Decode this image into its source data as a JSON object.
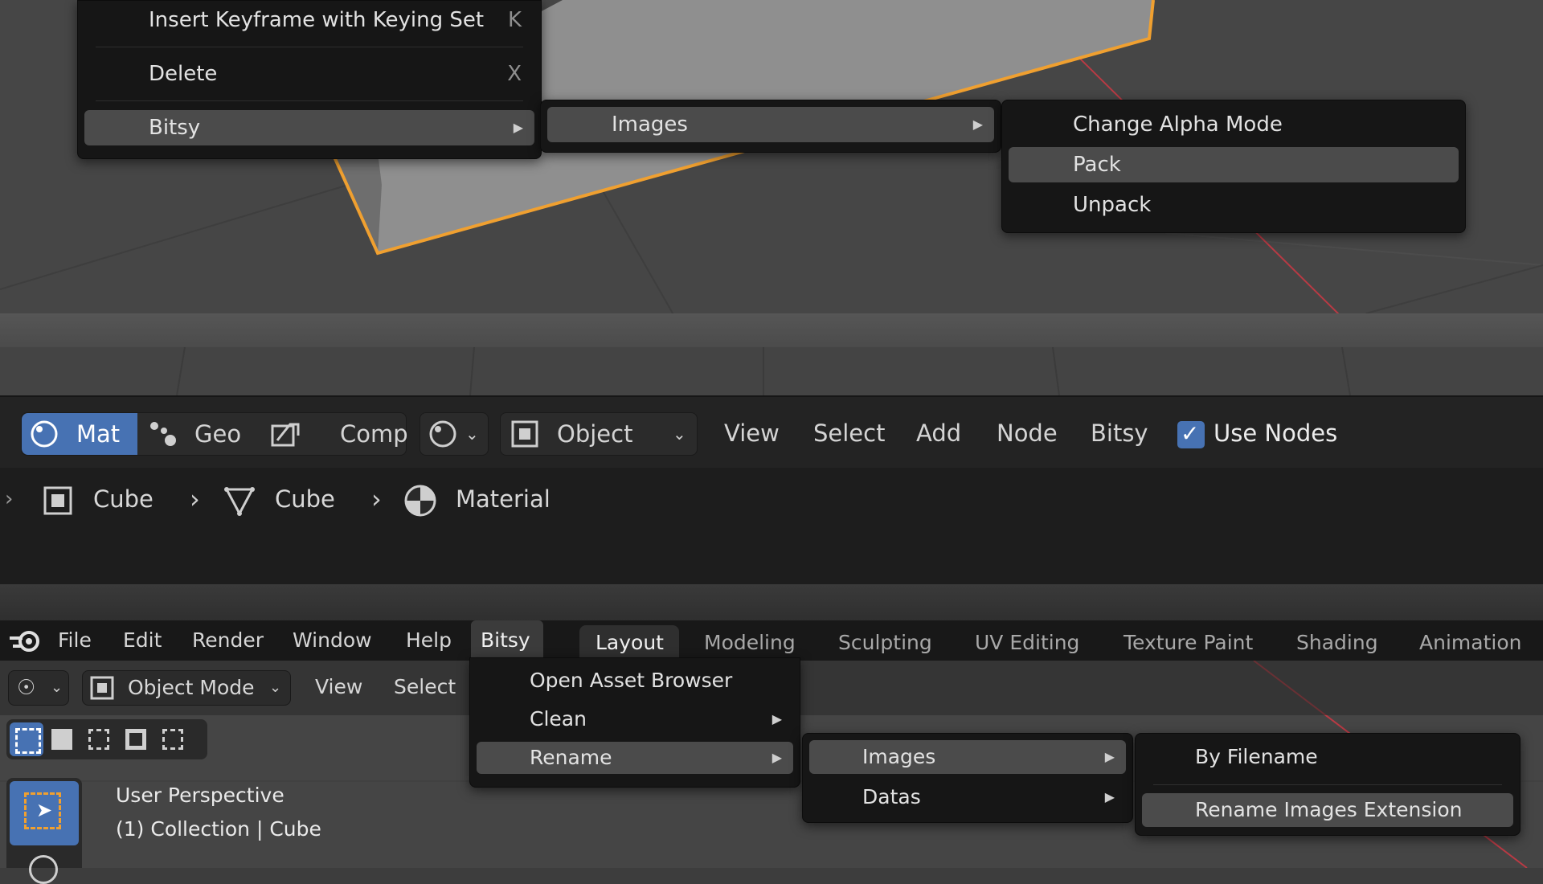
{
  "top_context_menu": {
    "items": [
      {
        "label": "Insert Keyframe with Keying Set",
        "shortcut": "K"
      },
      {
        "label": "Delete",
        "shortcut": "X"
      },
      {
        "label": "Bitsy"
      }
    ],
    "bitsy_submenu": {
      "items": [
        {
          "label": "Images"
        }
      ]
    },
    "images_submenu": {
      "items": [
        {
          "label": "Change Alpha Mode"
        },
        {
          "label": "Pack"
        },
        {
          "label": "Unpack"
        }
      ]
    }
  },
  "node_header": {
    "tabs": [
      "Mat",
      "Geo",
      "Comp"
    ],
    "object_dropdown": "Object",
    "menus": [
      "View",
      "Select",
      "Add",
      "Node",
      "Bitsy"
    ],
    "use_nodes_label": "Use Nodes",
    "use_nodes_checked": true
  },
  "breadcrumb": {
    "items": [
      "Cube",
      "Cube",
      "Material"
    ]
  },
  "topbar": {
    "menus": [
      "File",
      "Edit",
      "Render",
      "Window",
      "Help",
      "Bitsy"
    ],
    "workspaces": [
      "Layout",
      "Modeling",
      "Sculpting",
      "UV Editing",
      "Texture Paint",
      "Shading",
      "Animation"
    ],
    "active_workspace": "Layout"
  },
  "viewport_header": {
    "mode": "Object Mode",
    "menus": [
      "View",
      "Select"
    ]
  },
  "viewport_overlay": {
    "perspective": "User Perspective",
    "collection": "(1) Collection | Cube"
  },
  "bitsy_menu": {
    "items": [
      {
        "label": "Open Asset Browser"
      },
      {
        "label": "Clean"
      },
      {
        "label": "Rename"
      }
    ]
  },
  "rename_submenu": {
    "items": [
      {
        "label": "Images"
      },
      {
        "label": "Datas"
      }
    ]
  },
  "rename_images_submenu": {
    "items": [
      {
        "label": "By Filename"
      },
      {
        "label": "Rename Images Extension"
      }
    ]
  },
  "colors": {
    "accent": "#4772b3",
    "selection_orange": "#f0a030",
    "axis_red": "#b93a44"
  }
}
